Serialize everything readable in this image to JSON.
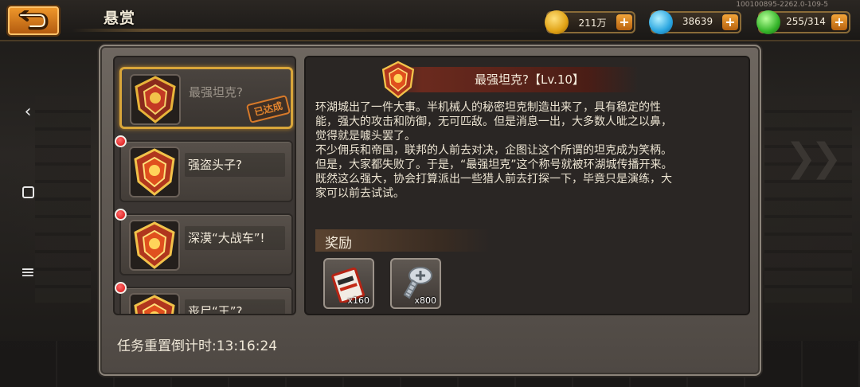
{
  "header": {
    "title": "悬赏",
    "build_id": "100100895-2262.0-109-5"
  },
  "resources": {
    "gold": "211万",
    "gems": "38639",
    "energy": "255/314"
  },
  "bounty_list": [
    {
      "label": "最强坦克?",
      "selected": true,
      "stamp": "已达成",
      "new": false
    },
    {
      "label": "强盗头子?",
      "selected": false,
      "new": true
    },
    {
      "label": "深漠“大战车”!",
      "selected": false,
      "new": true
    },
    {
      "label": "丧尸“王”?",
      "selected": false,
      "new": true
    }
  ],
  "detail": {
    "title": "最强坦克?【Lv.10】",
    "lines": [
      "环湖城出了一件大事。半机械人的秘密坦克制造出来了，具有稳定的性",
      "能，强大的攻击和防御，无可匹敌。但是消息一出，大多数人呲之以鼻，",
      "觉得就是噱头罢了。",
      "不少佣兵和帝国，联邦的人前去对决，企图让这个所谓的坦克成为笑柄。",
      "但是，大家都失败了。于是，“最强坦克”这个称号就被环湖城传播开来。",
      "既然这么强大，协会打算派出一些猎人前去打探一下，毕竟只是演练，大",
      "家可以前去试试。"
    ]
  },
  "rewards": {
    "header": "奖励",
    "items": [
      {
        "icon": "ticket-icon",
        "qty": "x160"
      },
      {
        "icon": "screw-icon",
        "qty": "x800"
      }
    ]
  },
  "timer": "任务重置倒计时:13:16:24",
  "colors": {
    "accent_orange": "#e0851f",
    "selected_border": "#d9a63a",
    "new_dot": "#d41010"
  }
}
